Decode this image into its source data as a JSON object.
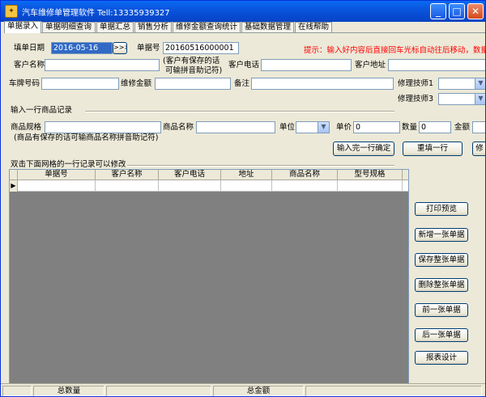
{
  "window": {
    "title": "汽车维修单管理软件 Tell:13335939327"
  },
  "tabs": [
    "单据录入",
    "单据明细查询",
    "单据汇总",
    "销售分析",
    "维修金额查询统计",
    "基础数据管理",
    "在线帮助"
  ],
  "form": {
    "date_label": "填单日期",
    "date_value": "2016-05-16",
    "date_button": ">>>",
    "doc_no_label": "单据号",
    "doc_no_value": "20160516000001",
    "hint": "提示：输入好内容后直接回车光标自动往后移动，数据",
    "customer_label": "客户名称",
    "customer_note_line1": "(客户有保存的话",
    "customer_note_line2": "可输拼音助记符)",
    "phone_label": "客户电话",
    "address_label": "客户地址",
    "plate_label": "车牌号码",
    "amount_label": "维修金额",
    "remark_label": "备注",
    "tech1_label": "修理技师1",
    "tech3_label": "修理技师3"
  },
  "item_section": {
    "title": "输入一行商品记录",
    "spec_label": "商品规格",
    "name_label": "商品名称",
    "unit_label": "单位",
    "price_label": "单价",
    "price_value": "0",
    "qty_label": "数量",
    "qty_value": "0",
    "total_label": "金额",
    "note": "(商品有保存的话可输商品名称拼音助记符)",
    "confirm_button": "输入完一行确定",
    "reinput_button": "重填一行",
    "modify_button": "修"
  },
  "grid": {
    "title": "双击下面网格的一行记录可以修改",
    "columns": [
      "单据号",
      "客户名称",
      "客户电话",
      "地址",
      "商品名称",
      "型号规格"
    ]
  },
  "actions": [
    "打印预览",
    "新增一张单据",
    "保存整张单据",
    "删除整张单据",
    "前一张单据",
    "后一张单据",
    "报表设计"
  ],
  "status": {
    "total_qty_label": "总数量",
    "total_amount_label": "总金额"
  }
}
